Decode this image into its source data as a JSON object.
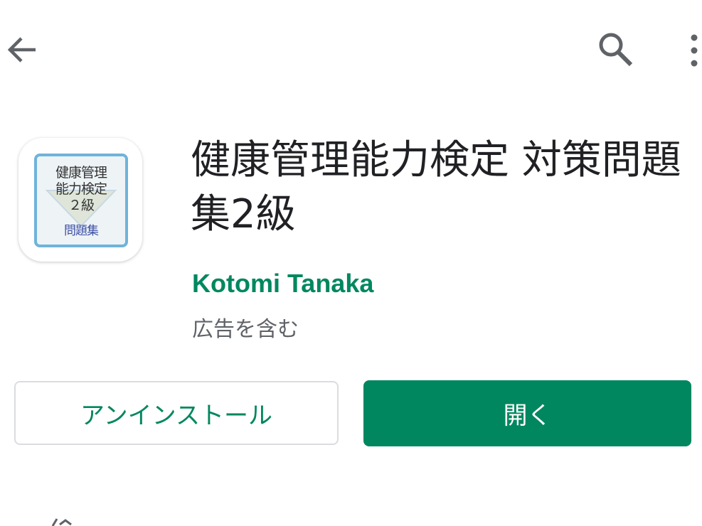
{
  "appbar": {
    "back_icon": "arrow-left-icon",
    "search_icon": "search-icon",
    "more_icon": "more-vert-icon"
  },
  "app": {
    "icon": {
      "line1": "健康管理",
      "line2": "能力検定",
      "line3": "２級",
      "line4": "問題集"
    },
    "title": "健康管理能力検定 対策問題集2級",
    "developer": "Kotomi Tanaka",
    "ads_note": "広告を含む"
  },
  "actions": {
    "uninstall_label": "アンインストール",
    "open_label": "開く"
  },
  "colors": {
    "accent": "#01875f",
    "text_primary": "#202124",
    "text_secondary": "#5f6368",
    "icon_border": "#6fb3db",
    "icon_sub": "#3b4ea5"
  }
}
